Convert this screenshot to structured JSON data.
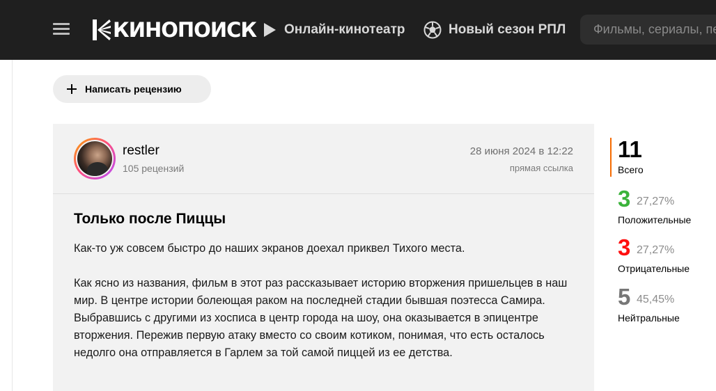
{
  "header": {
    "logo_text": "КИНОПОИСК",
    "nav": [
      {
        "label": "Онлайн-кинотеатр",
        "icon": "play-icon"
      },
      {
        "label": "Новый сезон РПЛ",
        "icon": "football-icon"
      }
    ],
    "search_placeholder": "Фильмы, сериалы, персоны"
  },
  "write_review_label": "Написать рецензию",
  "review": {
    "username": "restler",
    "review_count": "105 рецензий",
    "date": "28 июня 2024 в 12:22",
    "permalink_label": "прямая ссылка",
    "title": "Только после Пиццы",
    "paragraphs": [
      "Как-то уж совсем быстро до наших экранов доехал приквел Тихого места.",
      "Как ясно из названия, фильм в этот раз рассказывает историю вторжения пришельцев в наш мир. В центре истории болеющая раком на последней стадии бывшая поэтесса Самира. Выбравшись с другими из хосписа в центр города на шоу, она оказывается в эпицентре вторжения. Пережив первую атаку вместо со своим котиком, понимая, что есть осталось недолго она отправляется в Гарлем за той самой пиццей из ее детства."
    ]
  },
  "stats": {
    "total": "11",
    "total_label": "Всего",
    "accent_color": "#f56b00",
    "positive": {
      "count": "3",
      "percent": "27,27%",
      "label": "Положительные",
      "color": "#3bb33b"
    },
    "negative": {
      "count": "3",
      "percent": "27,27%",
      "label": "Отрицательные",
      "color": "#ff0f0f"
    },
    "neutral": {
      "count": "5",
      "percent": "45,45%",
      "label": "Нейтральные",
      "color": "#777777"
    }
  }
}
